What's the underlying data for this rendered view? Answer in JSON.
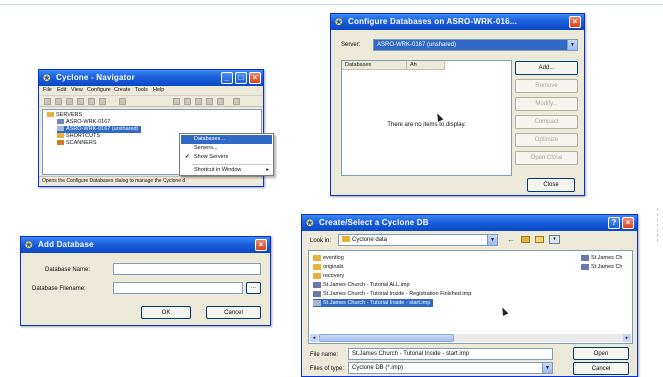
{
  "nav_window": {
    "title": "Cyclone - Navigator",
    "menu": [
      "File",
      "Edit",
      "View",
      "Configure",
      "Create",
      "Tools",
      "Help"
    ],
    "tree": {
      "root": "SERVERS",
      "server1": "ASRO-WRK-0167",
      "server2": "ASRO-WRK-0167 (unshared)",
      "item3": "SHORTCUTS",
      "item4": "SCANNERS"
    },
    "context_menu": [
      "Databases...",
      "Servers...",
      "Show Servers",
      "Shortcut in Window"
    ],
    "status": "Opens the Configure Databases dialog to manage the Cyclone d"
  },
  "configure_window": {
    "title": "Configure Databases on ASRO-WRK-016...",
    "server_label": "Server:",
    "server_value": "ASRO-WRK-0167 (unshared)",
    "columns": [
      "Databases",
      "Ah"
    ],
    "empty_message": "There are no items to display.",
    "buttons": [
      "Add...",
      "Remove",
      "Modify...",
      "Compact",
      "Optimize",
      "Open Close"
    ],
    "close_label": "Close"
  },
  "add_window": {
    "title": "Add Database",
    "name_label": "Database Name:",
    "filename_label": "Database Filename:",
    "browse_label": "...",
    "ok_label": "OK",
    "cancel_label": "Cancel"
  },
  "select_window": {
    "title": "Create/Select a Cyclone DB",
    "lookin_label": "Look in:",
    "lookin_value": "Cyclone data",
    "files": [
      "eventlog",
      "originals",
      "recovery",
      "St.James Church - Tutorial ALL.imp",
      "St.James Church - Tutorial Inside - Registration Finished.imp",
      "St.James Church - Tutorial Inside - start.imp"
    ],
    "right_files": [
      "St.James Ch",
      "St.James Ch"
    ],
    "filename_label": "File name:",
    "filename_value": "St.James Church - Tutorial Inside - start.imp",
    "filetype_label": "Files of type:",
    "filetype_value": "Cyclone DB (*.imp)",
    "open_label": "Open",
    "cancel_label": "Cancel"
  }
}
